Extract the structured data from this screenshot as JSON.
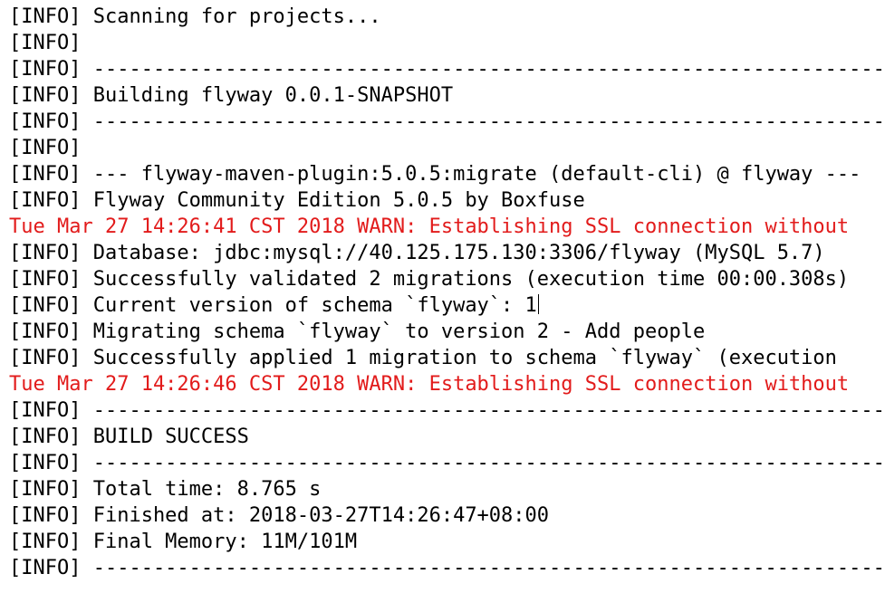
{
  "lines": [
    {
      "text": "[INFO] Scanning for projects...",
      "level": "info"
    },
    {
      "text": "[INFO]",
      "level": "info"
    },
    {
      "text": "[INFO] ------------------------------------------------------------------------",
      "level": "info"
    },
    {
      "text": "[INFO] Building flyway 0.0.1-SNAPSHOT",
      "level": "info"
    },
    {
      "text": "[INFO] ------------------------------------------------------------------------",
      "level": "info"
    },
    {
      "text": "[INFO]",
      "level": "info"
    },
    {
      "text": "[INFO] --- flyway-maven-plugin:5.0.5:migrate (default-cli) @ flyway ---",
      "level": "info"
    },
    {
      "text": "[INFO] Flyway Community Edition 5.0.5 by Boxfuse",
      "level": "info"
    },
    {
      "text": "Tue Mar 27 14:26:41 CST 2018 WARN: Establishing SSL connection without",
      "level": "warn"
    },
    {
      "text": "[INFO] Database: jdbc:mysql://40.125.175.130:3306/flyway (MySQL 5.7)",
      "level": "info"
    },
    {
      "text": "[INFO] Successfully validated 2 migrations (execution time 00:00.308s)",
      "level": "info"
    },
    {
      "text": "[INFO] Current version of schema `flyway`: 1",
      "level": "info"
    },
    {
      "text": "[INFO] Migrating schema `flyway` to version 2 - Add people",
      "level": "info"
    },
    {
      "text": "[INFO] Successfully applied 1 migration to schema `flyway` (execution",
      "level": "info"
    },
    {
      "text": "Tue Mar 27 14:26:46 CST 2018 WARN: Establishing SSL connection without",
      "level": "warn"
    },
    {
      "text": "[INFO] ------------------------------------------------------------------------",
      "level": "info"
    },
    {
      "text": "[INFO] BUILD SUCCESS",
      "level": "info"
    },
    {
      "text": "[INFO] ------------------------------------------------------------------------",
      "level": "info"
    },
    {
      "text": "[INFO] Total time: 8.765 s",
      "level": "info"
    },
    {
      "text": "[INFO] Finished at: 2018-03-27T14:26:47+08:00",
      "level": "info"
    },
    {
      "text": "[INFO] Final Memory: 11M/101M",
      "level": "info"
    },
    {
      "text": "[INFO] ------------------------------------------------------------------------",
      "level": "info"
    }
  ],
  "colors": {
    "info": "#000000",
    "warn": "#e21b1b",
    "background": "#ffffff"
  }
}
